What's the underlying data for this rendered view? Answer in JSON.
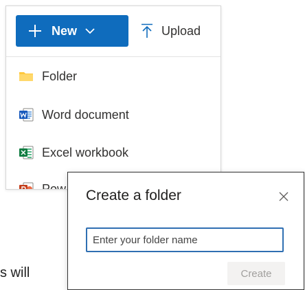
{
  "toolbar": {
    "new_label": "New",
    "upload_label": "Upload"
  },
  "menu": {
    "items": [
      {
        "label": "Folder",
        "icon": "folder-icon"
      },
      {
        "label": "Word document",
        "icon": "word-icon"
      },
      {
        "label": "Excel workbook",
        "icon": "excel-icon"
      },
      {
        "label": "Pow",
        "icon": "powerpoint-icon"
      }
    ]
  },
  "dialog": {
    "title": "Create a folder",
    "input_placeholder": "Enter your folder name",
    "create_label": "Create"
  },
  "background": {
    "text": "s will"
  },
  "colors": {
    "accent": "#0f6cbd",
    "folder": "#ffc83d",
    "word": "#185abd",
    "excel": "#107c41",
    "powerpoint": "#c43e1c",
    "disabled_text": "#a19f9d"
  }
}
